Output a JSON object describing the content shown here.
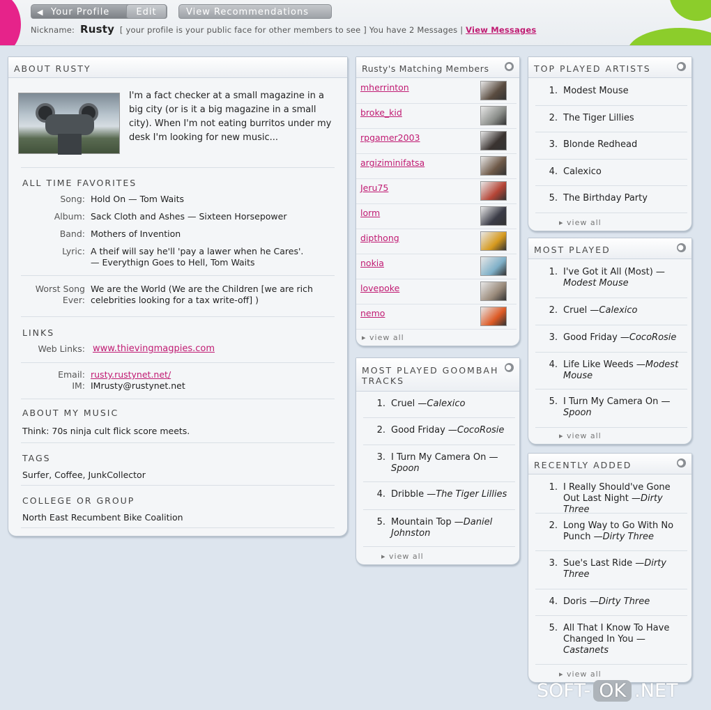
{
  "header": {
    "tab_profile": "Your Profile",
    "tab_edit": "Edit",
    "tab_recommendations": "View Recommendations",
    "nickname_label": "Nickname:",
    "nickname": "Rusty",
    "profile_note": "[ your profile is your public face for other members to see ]",
    "messages_text": "You have 2 Messages |",
    "messages_link": "View Messages"
  },
  "about": {
    "title": "ABOUT RUSTY",
    "bio": "I'm a fact checker at a small magazine in a big city (or is it a big magazine in a small city). When I'm not eating burritos under my desk I'm looking for new music...",
    "favorites_title": "ALL TIME FAVORITES",
    "song_label": "Song:",
    "song": "Hold On — Tom Waits",
    "album_label": "Album:",
    "album": "Sack Cloth and Ashes — Sixteen Horsepower",
    "band_label": "Band:",
    "band": "Mothers of Invention",
    "lyric_label": "Lyric:",
    "lyric_1": "A theif will say he'll 'pay a lawer when he Cares'.",
    "lyric_2": "— Everythign Goes to Hell, Tom Waits",
    "worst_label_1": "Worst Song",
    "worst_label_2": "Ever:",
    "worst_1": "We are the World (We are the Children [we are rich",
    "worst_2": "celebrities looking for a tax write-off] )",
    "links_title": "LINKS",
    "weblinks_label": "Web Links:",
    "weblink": "www.thievingmagpies.com",
    "email_label": "Email:",
    "email": "rusty.rustynet.net/",
    "im_label": "IM:",
    "im": "IMrusty@rustynet.net",
    "music_title": "ABOUT MY MUSIC",
    "music": "Think: 70s ninja cult flick score meets.",
    "tags_title": "TAGS",
    "tags": "Surfer, Coffee, JunkCollector",
    "college_title": "COLLEGE OR GROUP",
    "college": "North East Recumbent Bike Coalition"
  },
  "members": {
    "title": "Rusty's Matching Members",
    "items": [
      {
        "name": "mherrinton",
        "color": "#5a4c40"
      },
      {
        "name": "broke_kid",
        "color": "#8b8e8a"
      },
      {
        "name": "rpgamer2003",
        "color": "#3a3330"
      },
      {
        "name": "argiziminifatsa",
        "color": "#6e5948"
      },
      {
        "name": "Jeru75",
        "color": "#b54536"
      },
      {
        "name": "lorm",
        "color": "#3b3c47"
      },
      {
        "name": "dipthong",
        "color": "#d69a1e"
      },
      {
        "name": "nokia",
        "color": "#7fb0c8"
      },
      {
        "name": "lovepoke",
        "color": "#9a8a7a"
      },
      {
        "name": "nemo",
        "color": "#dd5a25"
      }
    ],
    "view_all": "▸ view all"
  },
  "goombah": {
    "title": "MOST PLAYED GOOMBAH TRACKS",
    "items": [
      {
        "num": "1.",
        "title": "Cruel",
        "artist": "—Calexico"
      },
      {
        "num": "2.",
        "title": "Good Friday",
        "artist": "—CocoRosie"
      },
      {
        "num": "3.",
        "title": "I Turn My Camera On",
        "artist": "—Spoon"
      },
      {
        "num": "4.",
        "title": "Dribble",
        "artist": "—The Tiger Lillies"
      },
      {
        "num": "5.",
        "title": "Mountain Top",
        "artist": "—Daniel Johnston"
      }
    ],
    "view_all": "▸ view all"
  },
  "artists": {
    "title": "TOP PLAYED ARTISTS",
    "items": [
      {
        "num": "1.",
        "title": "Modest Mouse",
        "artist": ""
      },
      {
        "num": "2.",
        "title": "The Tiger Lillies",
        "artist": ""
      },
      {
        "num": "3.",
        "title": "Blonde Redhead",
        "artist": ""
      },
      {
        "num": "4.",
        "title": "Calexico",
        "artist": ""
      },
      {
        "num": "5.",
        "title": "The Birthday Party",
        "artist": ""
      }
    ],
    "view_all": "▸ view all"
  },
  "mostplayed": {
    "title": "MOST PLAYED",
    "items": [
      {
        "num": "1.",
        "title": "I've Got it All (Most)",
        "artist": "—Modest Mouse"
      },
      {
        "num": "2.",
        "title": "Cruel",
        "artist": "—Calexico"
      },
      {
        "num": "3.",
        "title": "Good Friday",
        "artist": "—CocoRosie"
      },
      {
        "num": "4.",
        "title": "Life Like Weeds",
        "artist": "—Modest Mouse"
      },
      {
        "num": "5.",
        "title": "I Turn My Camera On",
        "artist": "—Spoon"
      }
    ],
    "view_all": "▸ view all"
  },
  "recent": {
    "title": "RECENTLY ADDED",
    "items": [
      {
        "num": "1.",
        "title": "I Really Should've Gone Out Last Night",
        "artist": "—Dirty Three"
      },
      {
        "num": "2.",
        "title": "Long Way to Go With No Punch",
        "artist": "—Dirty Three"
      },
      {
        "num": "3.",
        "title": "Sue's Last Ride",
        "artist": "—Dirty Three"
      },
      {
        "num": "4.",
        "title": "Doris",
        "artist": "—Dirty Three"
      },
      {
        "num": "5.",
        "title": "All That I Know To Have Changed In You",
        "artist": "—Castanets"
      }
    ],
    "view_all": "▸ view all"
  },
  "watermark": {
    "left": "SOFT-",
    "ok": "OK",
    "right": ".NET"
  },
  "colors": {
    "accent_pink": "#c01a72",
    "brand_green": "#8ccd2b",
    "brand_magenta": "#e6238a",
    "background": "#dde5ee"
  }
}
